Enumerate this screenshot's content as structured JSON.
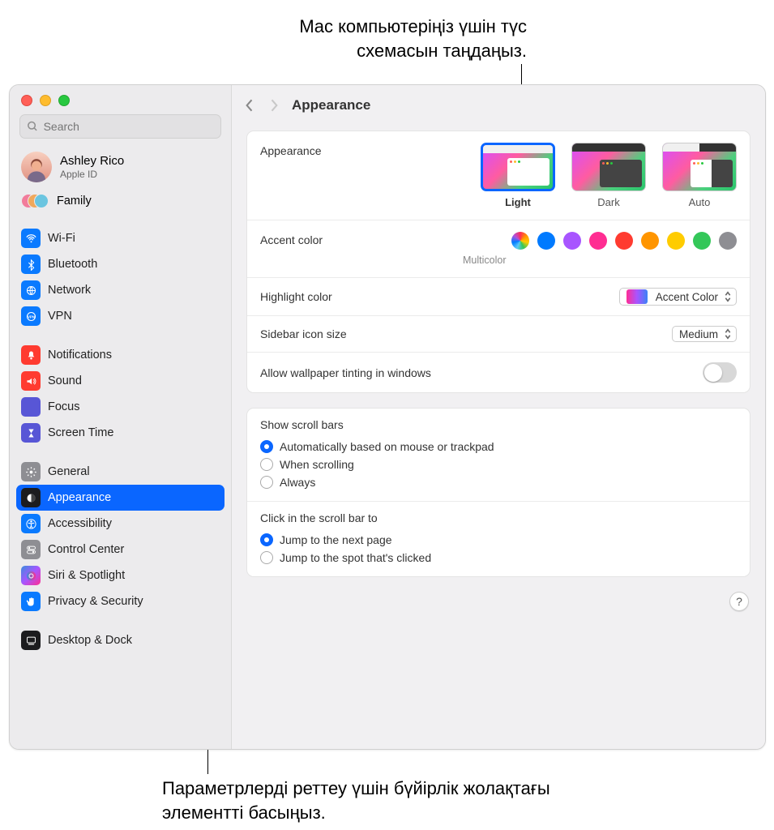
{
  "annotations": {
    "top": "Mac компьютеріңіз үшін түс схемасын таңдаңыз.",
    "bottom": "Параметрлерді реттеу үшін бүйірлік жолақтағы элементті басыңыз."
  },
  "search": {
    "placeholder": "Search"
  },
  "profile": {
    "name": "Ashley Rico",
    "sub": "Apple ID"
  },
  "family": {
    "label": "Family"
  },
  "sidebar": {
    "group1": [
      {
        "label": "Wi-Fi",
        "color": "#0a7aff",
        "icon": "wifi"
      },
      {
        "label": "Bluetooth",
        "color": "#0a7aff",
        "icon": "bluetooth"
      },
      {
        "label": "Network",
        "color": "#0a7aff",
        "icon": "network"
      },
      {
        "label": "VPN",
        "color": "#0a7aff",
        "icon": "vpn"
      }
    ],
    "group2": [
      {
        "label": "Notifications",
        "color": "#ff3b30",
        "icon": "bell"
      },
      {
        "label": "Sound",
        "color": "#ff3b30",
        "icon": "sound"
      },
      {
        "label": "Focus",
        "color": "#5856d6",
        "icon": "moon"
      },
      {
        "label": "Screen Time",
        "color": "#5856d6",
        "icon": "hourglass"
      }
    ],
    "group3": [
      {
        "label": "General",
        "color": "#8e8e93",
        "icon": "gear"
      },
      {
        "label": "Appearance",
        "color": "#1c1c1e",
        "icon": "appearance",
        "selected": true
      },
      {
        "label": "Accessibility",
        "color": "#0a7aff",
        "icon": "accessibility"
      },
      {
        "label": "Control Center",
        "color": "#8e8e93",
        "icon": "controlcenter"
      },
      {
        "label": "Siri & Spotlight",
        "color": "gradient",
        "icon": "siri"
      },
      {
        "label": "Privacy & Security",
        "color": "#0a7aff",
        "icon": "hand"
      }
    ],
    "group4": [
      {
        "label": "Desktop & Dock",
        "color": "#1c1c1e",
        "icon": "dock"
      }
    ]
  },
  "header": {
    "title": "Appearance"
  },
  "appearance": {
    "label": "Appearance",
    "options": [
      {
        "label": "Light",
        "selected": true
      },
      {
        "label": "Dark"
      },
      {
        "label": "Auto"
      }
    ]
  },
  "accent": {
    "label": "Accent color",
    "sub": "Multicolor",
    "colors": [
      "multicolor",
      "#007aff",
      "#a855ff",
      "#ff2d92",
      "#ff3b30",
      "#ff9500",
      "#ffcc00",
      "#34c759",
      "#8e8e93"
    ]
  },
  "highlight": {
    "label": "Highlight color",
    "value": "Accent Color"
  },
  "sidebarIconSize": {
    "label": "Sidebar icon size",
    "value": "Medium"
  },
  "wallpaperTint": {
    "label": "Allow wallpaper tinting in windows"
  },
  "scrollBars": {
    "title": "Show scroll bars",
    "options": [
      {
        "label": "Automatically based on mouse or trackpad",
        "checked": true
      },
      {
        "label": "When scrolling"
      },
      {
        "label": "Always"
      }
    ]
  },
  "scrollClick": {
    "title": "Click in the scroll bar to",
    "options": [
      {
        "label": "Jump to the next page",
        "checked": true
      },
      {
        "label": "Jump to the spot that's clicked"
      }
    ]
  },
  "help": "?"
}
